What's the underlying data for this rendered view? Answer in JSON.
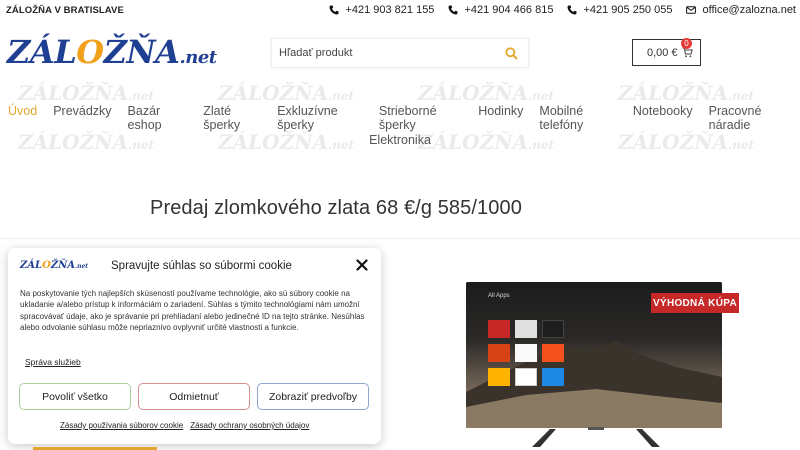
{
  "topbar": {
    "brand": "ZÁLOŽŇA V BRATISLAVE",
    "contacts": [
      {
        "icon": "phone-icon",
        "text": "+421 903 821 155"
      },
      {
        "icon": "phone-icon",
        "text": "+421 904 466 815"
      },
      {
        "icon": "phone-icon",
        "text": "+421 905 250 055"
      },
      {
        "icon": "mail-icon",
        "text": "office@zalozna.net"
      }
    ]
  },
  "header": {
    "logo_main_1": "ZÁL",
    "logo_o": "O",
    "logo_main_2": "ŽŇA",
    "logo_net": ".net",
    "search_placeholder": "Hľadať produkt",
    "cart_total": "0,00 €",
    "cart_count": "0"
  },
  "nav": {
    "items": [
      "Úvod",
      "Prevádzky",
      "Bazár eshop",
      "Zlaté šperky",
      "Exkluzívne šperky",
      "Strieborné šperky",
      "Hodinky",
      "Mobilné telefóny",
      "Notebooky",
      "Pracovné náradie"
    ],
    "row2": "Elektronika",
    "watermark": "ZÁLOŽŇA",
    "watermark_suffix": ".net"
  },
  "main": {
    "headline": "Predaj zlomkového zlata 68 €/g 585/1000",
    "deal_badge": "VÝHODNÁ KÚPA",
    "tv_apps_label": "All Apps"
  },
  "cookie": {
    "logo_main_1": "ZÁL",
    "logo_o": "O",
    "logo_main_2": "ŽŇA",
    "logo_net": ".net",
    "title": "Spravujte súhlas so súbormi cookie",
    "text": "Na poskytovanie tých najlepších skúseností používame technológie, ako sú súbory cookie na ukladanie a/alebo prístup k informáciám o zariadení. Súhlas s týmito technológiami nám umožní spracovávať údaje, ako je správanie pri prehliadaní alebo jedinečné ID na tejto stránke. Nesúhlas alebo odvolanie súhlasu môže nepriaznivo ovplyvniť určité vlastnosti a funkcie.",
    "manage_link": "Správa služieb",
    "accept": "Povoliť všetko",
    "deny": "Odmietnuť",
    "prefs": "Zobraziť predvoľby",
    "footer_links": [
      "Zásady používania súborov cookie",
      "Zásady ochrany osobných údajov"
    ]
  },
  "colors": {
    "brand_blue": "#1f3f92",
    "accent_orange": "#e3a72f",
    "badge_red": "#c62828"
  }
}
